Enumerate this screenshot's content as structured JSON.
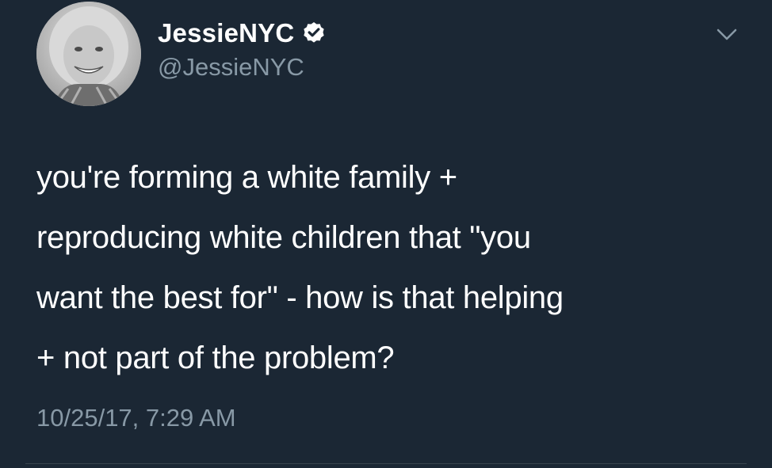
{
  "user": {
    "display_name": "JessieNYC",
    "handle": "@JessieNYC",
    "verified": true,
    "avatar": "grayscale-profile-photo"
  },
  "tweet": {
    "text": "you're forming a white family +\nreproducing white children that \"you\nwant the best for\" - how is that helping\n+ not part of the problem?",
    "timestamp": "10/25/17, 7:29 AM"
  },
  "icons": {
    "verified": "verified-badge-icon",
    "menu": "chevron-down-icon"
  },
  "colors": {
    "background": "#1b2734",
    "primary_text": "#ffffff",
    "secondary_text": "#8899a6",
    "divider": "#38444d"
  }
}
